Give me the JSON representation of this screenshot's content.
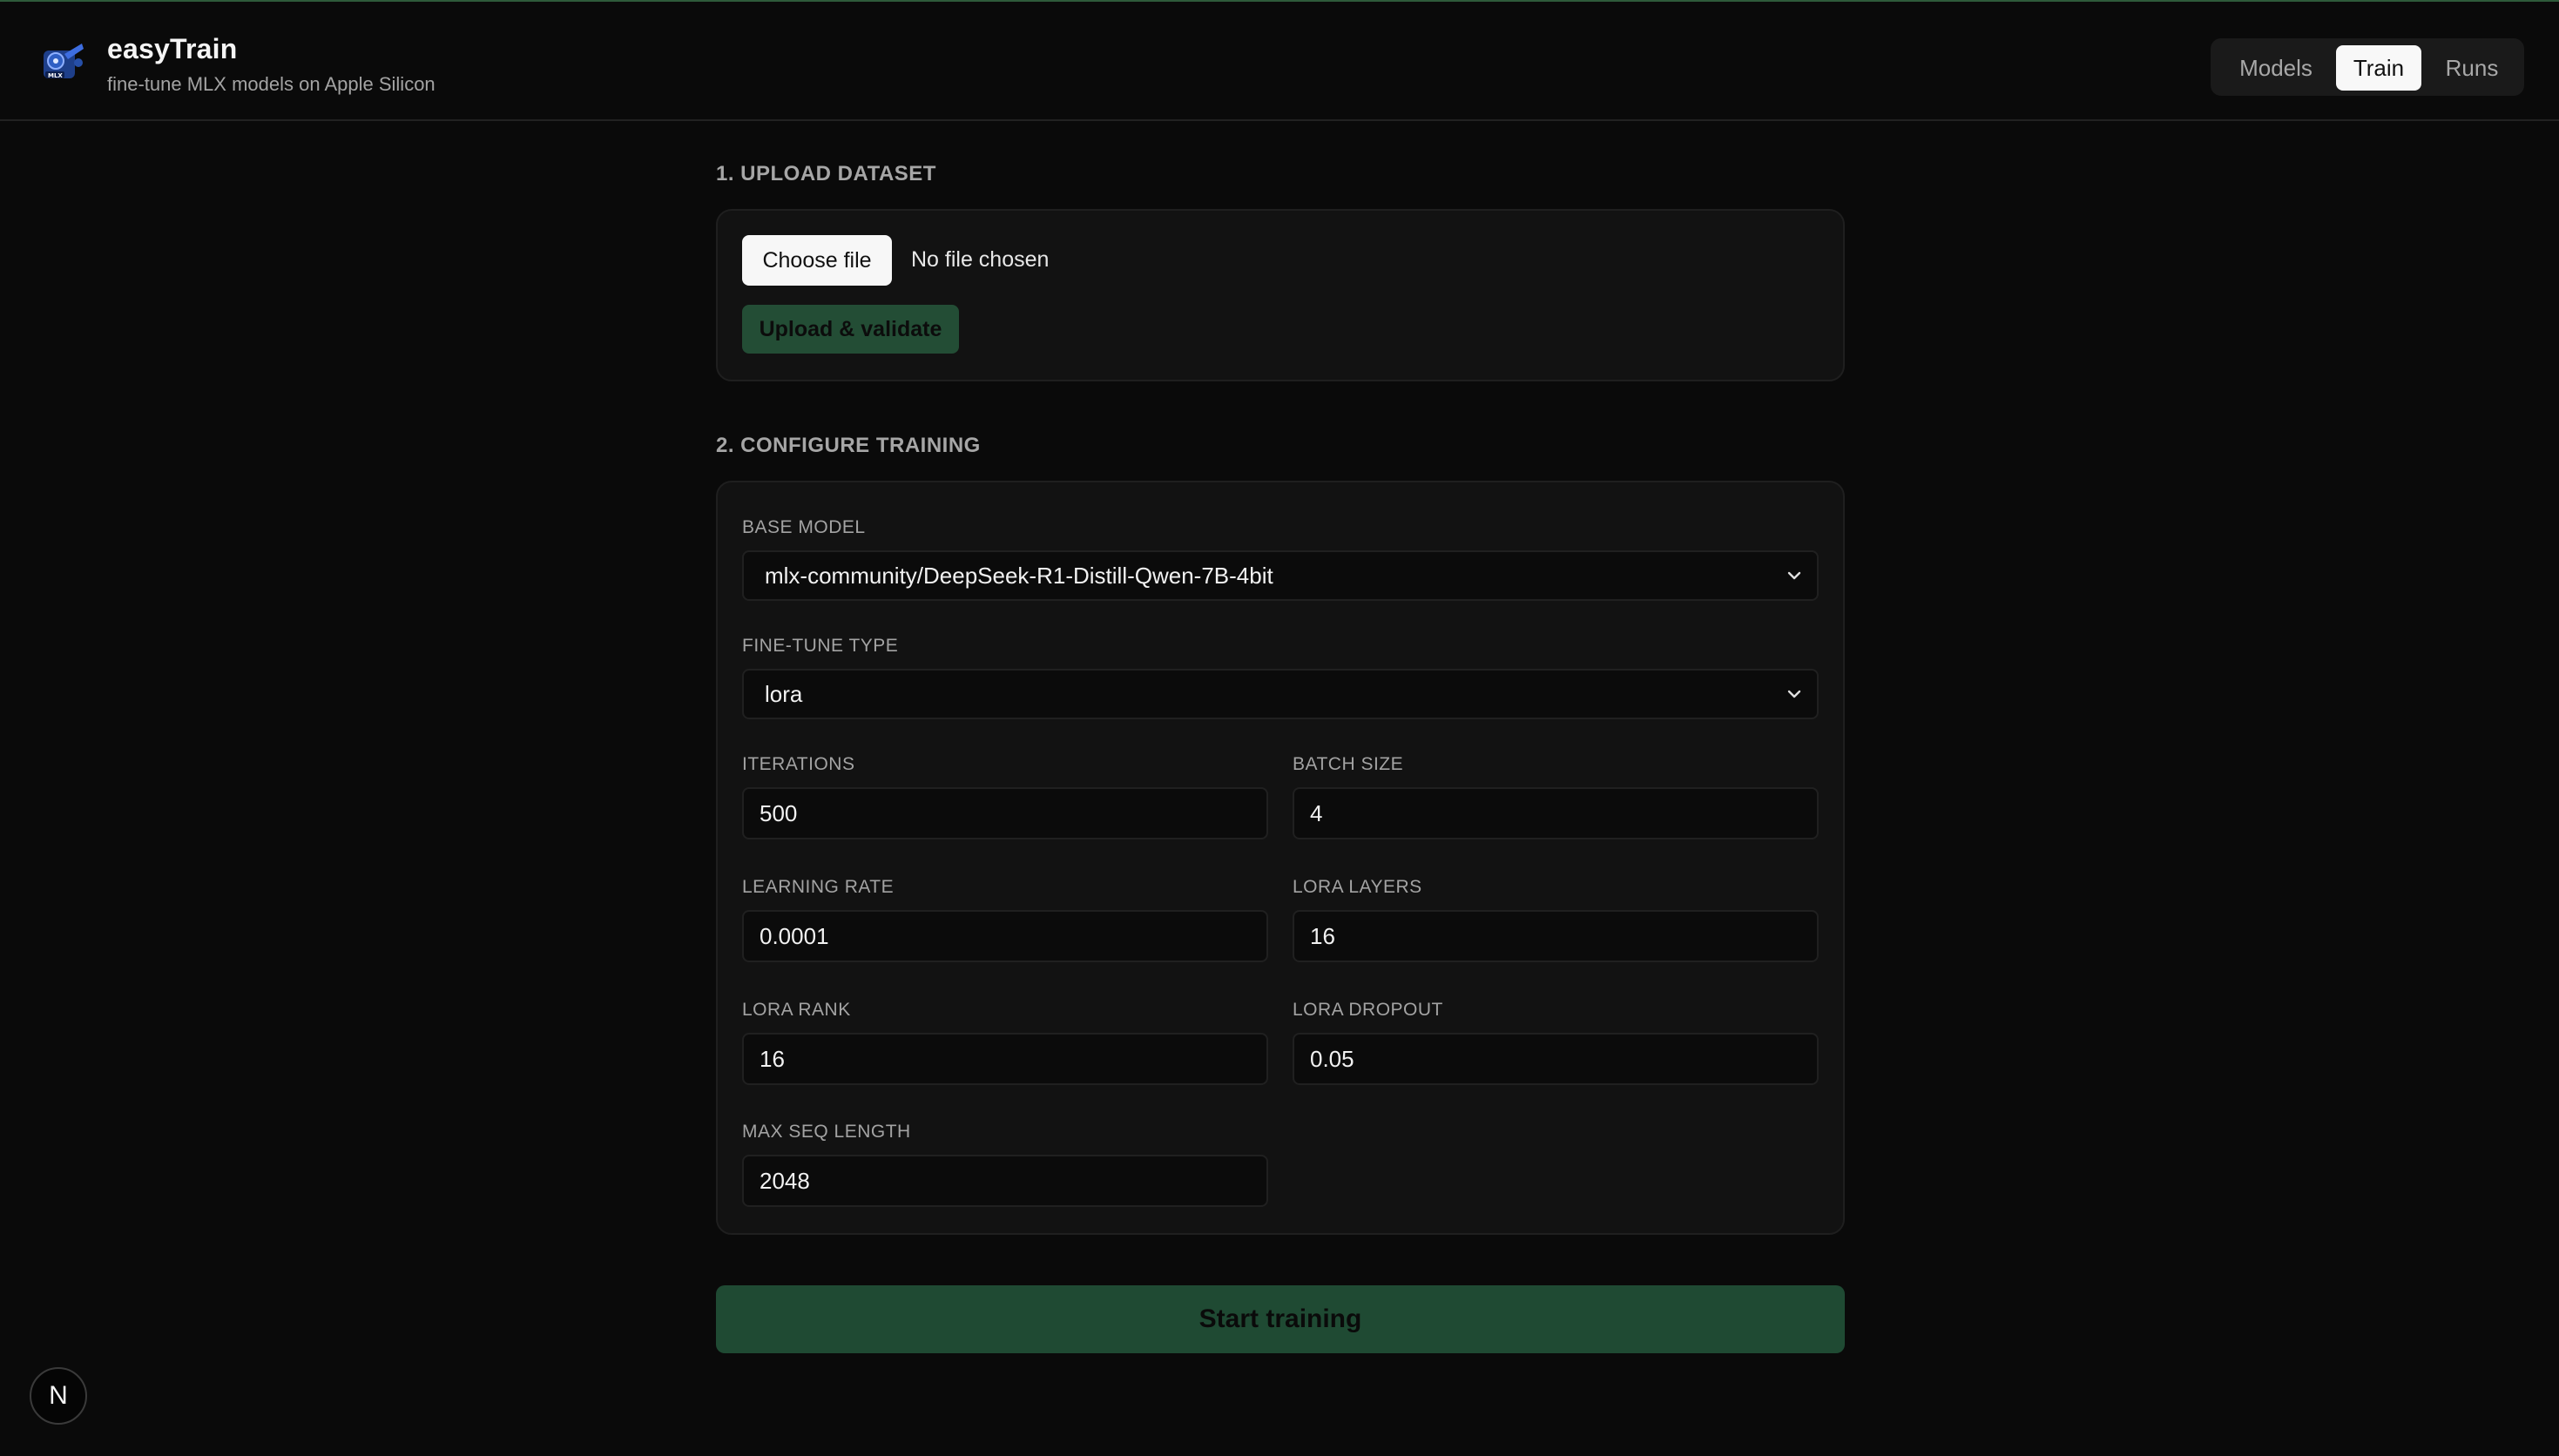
{
  "app": {
    "title": "easyTrain",
    "subtitle": "fine-tune MLX models on Apple Silicon",
    "logo_icon": "mlx-logo-icon"
  },
  "nav": {
    "items": [
      {
        "label": "Models",
        "active": false
      },
      {
        "label": "Train",
        "active": true
      },
      {
        "label": "Runs",
        "active": false
      }
    ]
  },
  "upload": {
    "section_title": "1. UPLOAD DATASET",
    "choose_file_label": "Choose file",
    "file_status": "No file chosen",
    "upload_button_label": "Upload & validate"
  },
  "configure": {
    "section_title": "2. CONFIGURE TRAINING",
    "base_model": {
      "label": "BASE MODEL",
      "value": "mlx-community/DeepSeek-R1-Distill-Qwen-7B-4bit"
    },
    "finetune_type": {
      "label": "FINE-TUNE TYPE",
      "value": "lora"
    },
    "iterations": {
      "label": "ITERATIONS",
      "value": "500"
    },
    "batch_size": {
      "label": "BATCH SIZE",
      "value": "4"
    },
    "learning_rate": {
      "label": "LEARNING RATE",
      "value": "0.0001"
    },
    "lora_layers": {
      "label": "LORA LAYERS",
      "value": "16"
    },
    "lora_rank": {
      "label": "LORA RANK",
      "value": "16"
    },
    "lora_dropout": {
      "label": "LORA DROPOUT",
      "value": "0.05"
    },
    "max_seq_length": {
      "label": "MAX SEQ LENGTH",
      "value": "2048"
    }
  },
  "start_button_label": "Start training",
  "dev_badge": "N",
  "colors": {
    "background": "#0a0a0a",
    "card": "#121212",
    "accent_green": "#234d35",
    "nav_active": "#f8f8f8"
  }
}
